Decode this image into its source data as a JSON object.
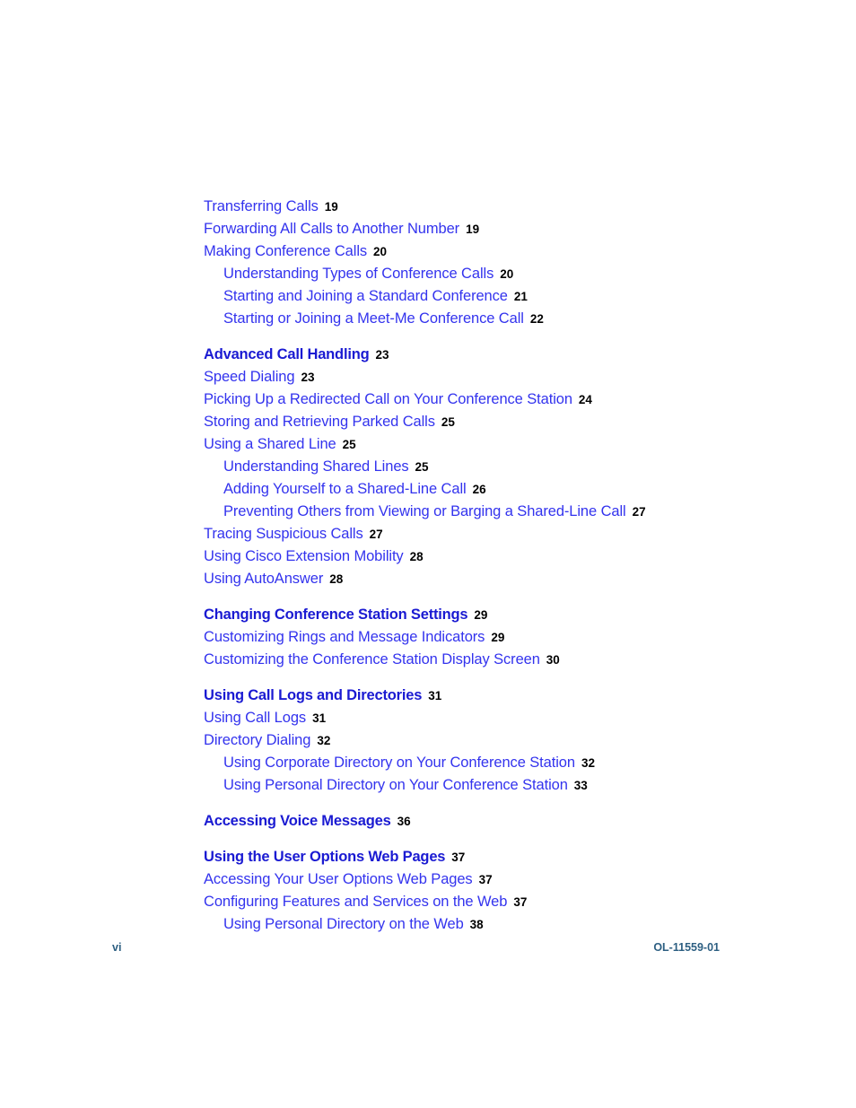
{
  "document": {
    "colors": {
      "link_blue": "#3333ee",
      "heading_blue": "#1a1ad2",
      "page_number_black": "#000000",
      "folio_blue": "#2d5f82",
      "background": "#ffffff"
    }
  },
  "toc": {
    "groups": [
      {
        "entries": [
          {
            "level": 1,
            "heading": false,
            "title": "Transferring Calls",
            "page": "19"
          },
          {
            "level": 1,
            "heading": false,
            "title": "Forwarding All Calls to Another Number",
            "page": "19"
          },
          {
            "level": 1,
            "heading": false,
            "title": "Making Conference Calls",
            "page": "20"
          },
          {
            "level": 2,
            "heading": false,
            "title": "Understanding Types of Conference Calls",
            "page": "20"
          },
          {
            "level": 2,
            "heading": false,
            "title": "Starting and Joining a Standard Conference",
            "page": "21"
          },
          {
            "level": 2,
            "heading": false,
            "title": "Starting or Joining a Meet-Me Conference Call",
            "page": "22"
          }
        ]
      },
      {
        "entries": [
          {
            "level": 1,
            "heading": true,
            "title": "Advanced Call Handling",
            "page": "23"
          },
          {
            "level": 1,
            "heading": false,
            "title": "Speed Dialing",
            "page": "23"
          },
          {
            "level": 1,
            "heading": false,
            "title": "Picking Up a Redirected Call on Your Conference Station",
            "page": "24"
          },
          {
            "level": 1,
            "heading": false,
            "title": "Storing and Retrieving Parked Calls",
            "page": "25"
          },
          {
            "level": 1,
            "heading": false,
            "title": "Using a Shared Line",
            "page": "25"
          },
          {
            "level": 2,
            "heading": false,
            "title": "Understanding Shared Lines",
            "page": "25"
          },
          {
            "level": 2,
            "heading": false,
            "title": "Adding Yourself to a Shared-Line Call",
            "page": "26"
          },
          {
            "level": 2,
            "heading": false,
            "title": "Preventing Others from Viewing or Barging a Shared-Line Call",
            "page": "27"
          },
          {
            "level": 1,
            "heading": false,
            "title": "Tracing Suspicious Calls",
            "page": "27"
          },
          {
            "level": 1,
            "heading": false,
            "title": "Using Cisco Extension Mobility",
            "page": "28"
          },
          {
            "level": 1,
            "heading": false,
            "title": "Using AutoAnswer",
            "page": "28"
          }
        ]
      },
      {
        "entries": [
          {
            "level": 1,
            "heading": true,
            "title": "Changing Conference Station Settings",
            "page": "29"
          },
          {
            "level": 1,
            "heading": false,
            "title": "Customizing Rings and Message Indicators",
            "page": "29"
          },
          {
            "level": 1,
            "heading": false,
            "title": "Customizing the Conference Station Display Screen",
            "page": "30"
          }
        ]
      },
      {
        "entries": [
          {
            "level": 1,
            "heading": true,
            "title": "Using Call Logs and Directories",
            "page": "31"
          },
          {
            "level": 1,
            "heading": false,
            "title": "Using Call Logs",
            "page": "31"
          },
          {
            "level": 1,
            "heading": false,
            "title": "Directory Dialing",
            "page": "32"
          },
          {
            "level": 2,
            "heading": false,
            "title": "Using Corporate Directory on Your Conference Station",
            "page": "32"
          },
          {
            "level": 2,
            "heading": false,
            "title": "Using Personal Directory on Your Conference Station",
            "page": "33"
          }
        ]
      },
      {
        "entries": [
          {
            "level": 1,
            "heading": true,
            "title": "Accessing Voice Messages",
            "page": "36"
          }
        ]
      },
      {
        "entries": [
          {
            "level": 1,
            "heading": true,
            "title": "Using the User Options Web Pages",
            "page": "37"
          },
          {
            "level": 1,
            "heading": false,
            "title": "Accessing Your User Options Web Pages",
            "page": "37"
          },
          {
            "level": 1,
            "heading": false,
            "title": "Configuring Features and Services on the Web",
            "page": "37"
          },
          {
            "level": 2,
            "heading": false,
            "title": "Using Personal Directory on the Web",
            "page": "38"
          }
        ]
      }
    ]
  },
  "footer": {
    "folio": "vi",
    "doc_id": "OL-11559-01"
  }
}
